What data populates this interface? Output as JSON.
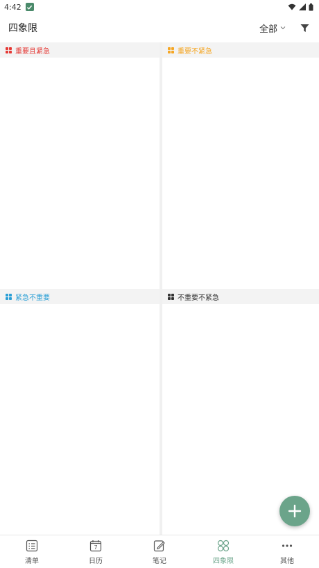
{
  "status_bar": {
    "time": "4:42"
  },
  "header": {
    "title": "四象限",
    "filter_label": "全部"
  },
  "quadrants": [
    {
      "label": "重要且紧急",
      "color": "#e53935"
    },
    {
      "label": "重要不紧急",
      "color": "#f5a623"
    },
    {
      "label": "紧急不重要",
      "color": "#2a9fd6"
    },
    {
      "label": "不重要不紧急",
      "color": "#333333"
    }
  ],
  "bottom_nav": [
    {
      "label": "清单",
      "icon": "list-icon"
    },
    {
      "label": "日历",
      "icon": "calendar-icon",
      "day": "7"
    },
    {
      "label": "笔记",
      "icon": "note-icon"
    },
    {
      "label": "四象限",
      "icon": "quadrant-icon",
      "active": true
    },
    {
      "label": "其他",
      "icon": "more-icon"
    }
  ],
  "colors": {
    "accent": "#6ba48a",
    "header_bg": "#f3f3f3"
  }
}
